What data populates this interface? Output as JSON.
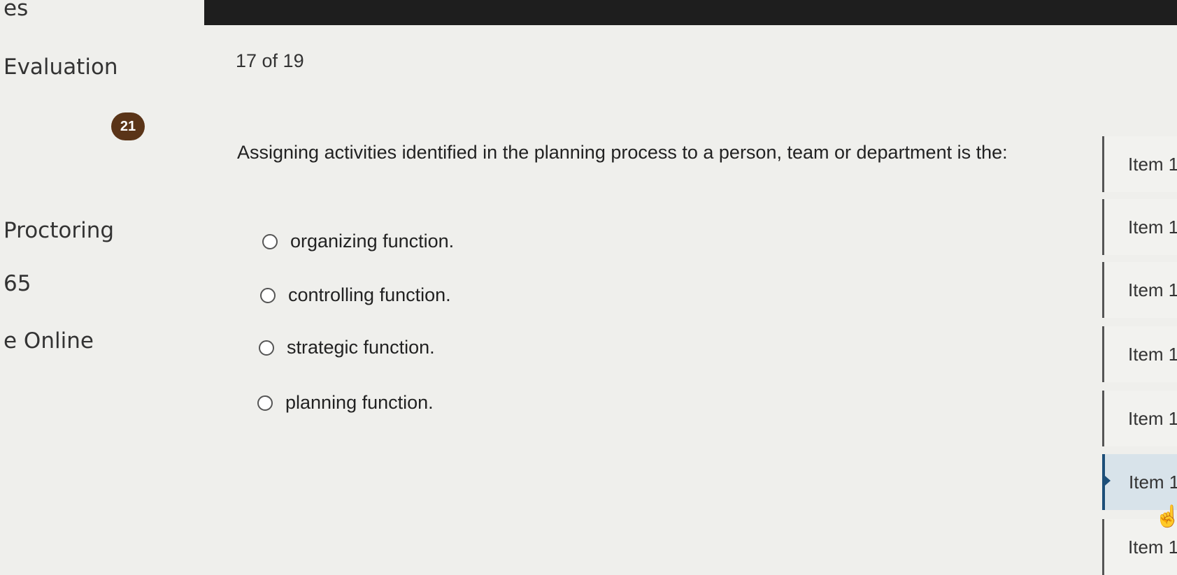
{
  "left_nav": {
    "items": [
      "es",
      "Evaluation",
      "Proctoring",
      "65",
      "e Online"
    ]
  },
  "progress": "17 of 19",
  "question": {
    "number": "21",
    "text": "Assigning activities identified in the planning process to a person, team or department is the:",
    "options": [
      "organizing function.",
      "controlling function.",
      "strategic function.",
      "planning function."
    ]
  },
  "item_nav": {
    "items": [
      "Item 1",
      "Item 1",
      "Item 1",
      "Item 1",
      "Item 1",
      "Item 1",
      "Item 1"
    ],
    "active_index": 5
  },
  "icons": {
    "cursor": "hand-pointer-icon"
  },
  "colors": {
    "badge": "#5a3418",
    "active_item": "#d8e3ea",
    "accent": "#1d4f79"
  }
}
